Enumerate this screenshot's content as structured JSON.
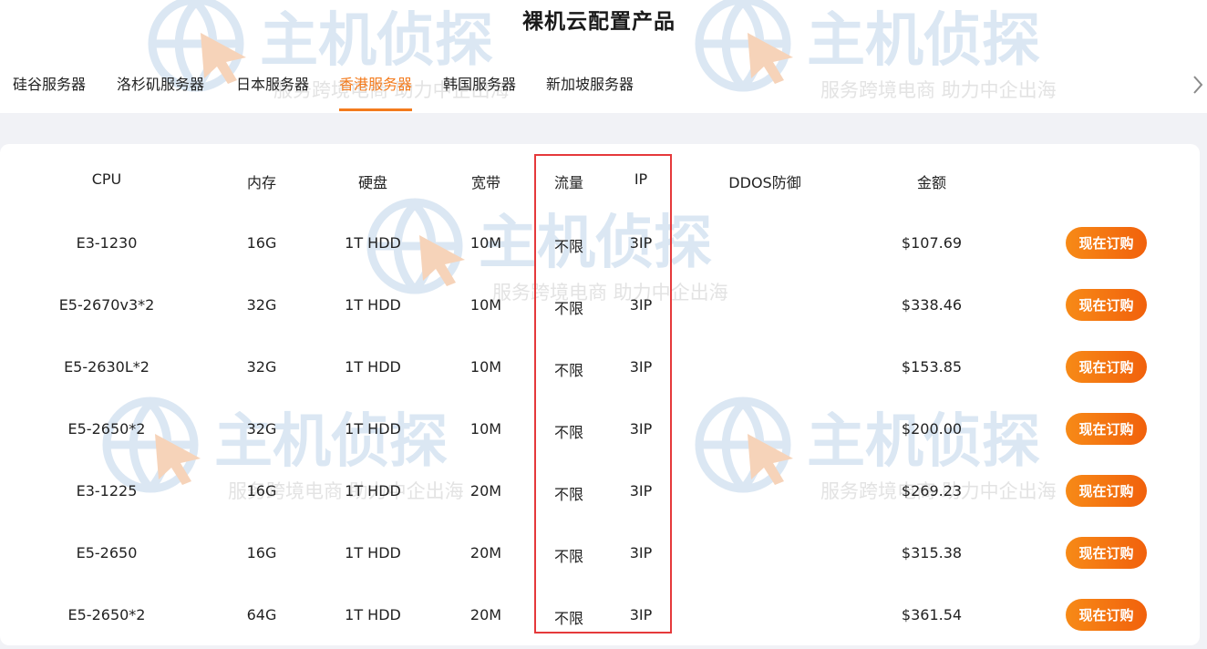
{
  "page": {
    "title": "裸机云配置产品"
  },
  "tabs": [
    {
      "label": "硅谷服务器",
      "active": false
    },
    {
      "label": "洛杉矶服务器",
      "active": false
    },
    {
      "label": "日本服务器",
      "active": false
    },
    {
      "label": "香港服务器",
      "active": true
    },
    {
      "label": "韩国服务器",
      "active": false
    },
    {
      "label": "新加坡服务器",
      "active": false
    }
  ],
  "table": {
    "headers": {
      "cpu": "CPU",
      "memory": "内存",
      "disk": "硬盘",
      "bandwidth": "宽带",
      "traffic": "流量",
      "ip": "IP",
      "ddos": "DDOS防御",
      "price": "金额"
    },
    "rows": [
      {
        "cpu": "E3-1230",
        "memory": "16G",
        "disk": "1T HDD",
        "bandwidth": "10M",
        "traffic": "不限",
        "ip": "3IP",
        "ddos": "",
        "price": "$107.69"
      },
      {
        "cpu": "E5-2670v3*2",
        "memory": "32G",
        "disk": "1T HDD",
        "bandwidth": "10M",
        "traffic": "不限",
        "ip": "3IP",
        "ddos": "",
        "price": "$338.46"
      },
      {
        "cpu": "E5-2630L*2",
        "memory": "32G",
        "disk": "1T HDD",
        "bandwidth": "10M",
        "traffic": "不限",
        "ip": "3IP",
        "ddos": "",
        "price": "$153.85"
      },
      {
        "cpu": "E5-2650*2",
        "memory": "32G",
        "disk": "1T HDD",
        "bandwidth": "10M",
        "traffic": "不限",
        "ip": "3IP",
        "ddos": "",
        "price": "$200.00"
      },
      {
        "cpu": "E3-1225",
        "memory": "16G",
        "disk": "1T HDD",
        "bandwidth": "20M",
        "traffic": "不限",
        "ip": "3IP",
        "ddos": "",
        "price": "$269.23"
      },
      {
        "cpu": "E5-2650",
        "memory": "16G",
        "disk": "1T HDD",
        "bandwidth": "20M",
        "traffic": "不限",
        "ip": "3IP",
        "ddos": "",
        "price": "$315.38"
      },
      {
        "cpu": "E5-2650*2",
        "memory": "64G",
        "disk": "1T HDD",
        "bandwidth": "20M",
        "traffic": "不限",
        "ip": "3IP",
        "ddos": "",
        "price": "$361.54"
      }
    ],
    "order_label": "现在订购"
  },
  "watermark": {
    "brand": "主机侦探",
    "slogan": "服务跨境电商 助力中企出海"
  },
  "colors": {
    "accent": "#f37b1d",
    "button_start": "#f78a17",
    "button_end": "#f1610c",
    "highlight": "#e5393b",
    "watermark": "#dbe7f3"
  },
  "icons": {
    "tabs_next": "chevron-right-icon",
    "watermark_logo": "globe-cursor-icon"
  }
}
